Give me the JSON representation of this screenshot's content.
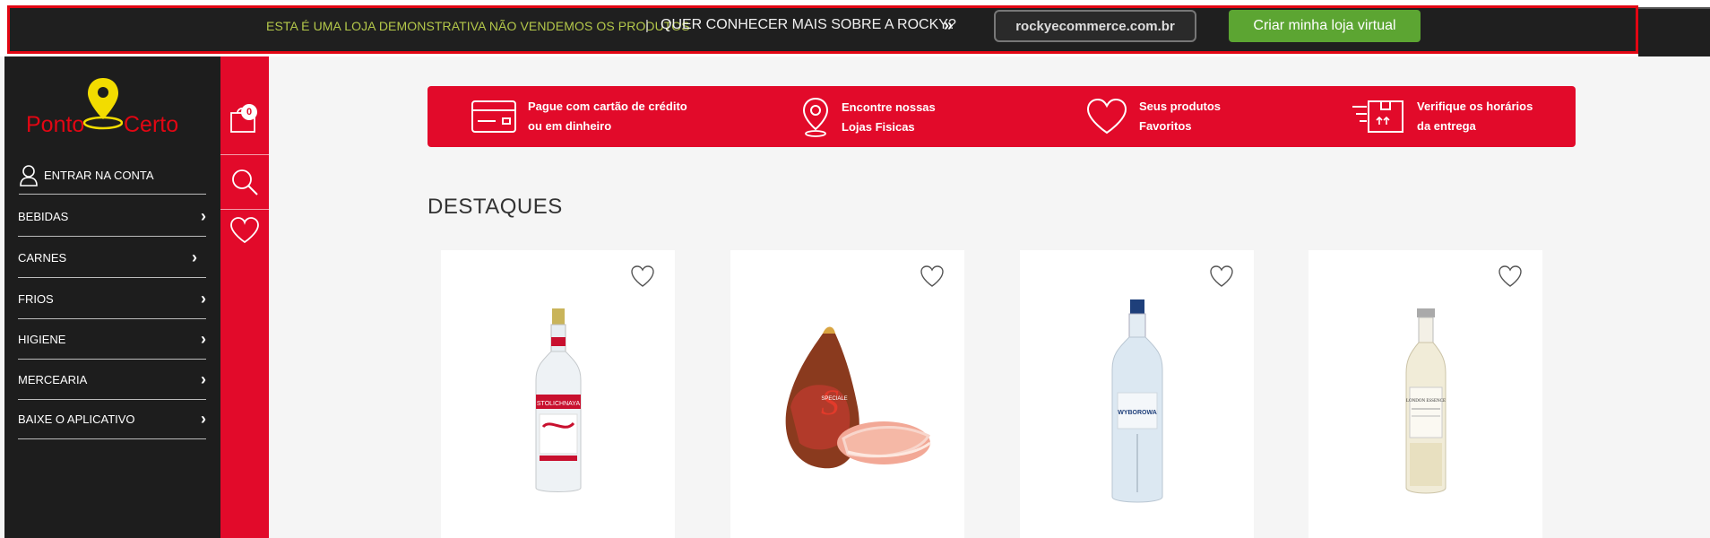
{
  "banner": {
    "demo_text": "ESTA É UMA LOJA DEMONSTRATIVA NÃO VENDEMOS OS PRODUTOS",
    "separator": "|",
    "question": "QUER CONHECER MAIS SOBRE A ROCKY?",
    "chevrons": "»",
    "url_button": "rockyecommerce.com.br",
    "cta_button": "Criar minha loja virtual"
  },
  "logo": {
    "word1": "Ponto",
    "word2": "Certo"
  },
  "account": {
    "label": "ENTRAR NA CONTA"
  },
  "menu": [
    {
      "label": "BEBIDAS"
    },
    {
      "label": "CARNES"
    },
    {
      "label": "FRIOS"
    },
    {
      "label": "HIGIENE"
    },
    {
      "label": "MERCEARIA"
    },
    {
      "label": "BAIXE O APLICATIVO"
    }
  ],
  "cart": {
    "count": "0"
  },
  "info": [
    {
      "line1": "Pague com cartão de crédito",
      "line2": "ou em dinheiro",
      "icon": "credit-card-icon"
    },
    {
      "line1": "Encontre nossas",
      "line2": "Lojas Fisicas",
      "icon": "location-pin-icon"
    },
    {
      "line1": "Seus produtos",
      "line2": "Favoritos",
      "icon": "heart-icon"
    },
    {
      "line1": "Verifique os horários",
      "line2": "da entrega",
      "icon": "delivery-box-icon"
    }
  ],
  "section": {
    "title": "DESTAQUES"
  },
  "products": [
    {
      "name": "vodka-bottle",
      "label": "STOLICHNAYA"
    },
    {
      "name": "ham-leg",
      "label": "SPECIALE"
    },
    {
      "name": "vodka-bottle-2",
      "label": "WYBOROWA"
    },
    {
      "name": "tonic-bottle",
      "label": "LONDON ESSENCE"
    }
  ],
  "colors": {
    "brand_red": "#e20a2a",
    "banner_green": "#5ca532",
    "sidebar_dark": "#1d1d1d"
  }
}
